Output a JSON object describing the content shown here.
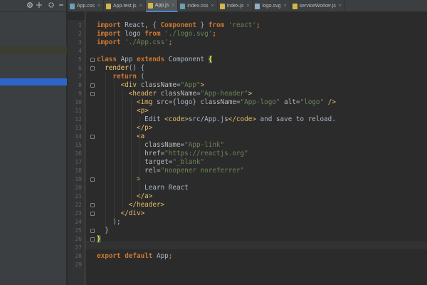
{
  "tabs": [
    {
      "label": "App.css",
      "icon_color": "#6a9fb5",
      "active": false
    },
    {
      "label": "App.test.js",
      "icon_color": "#d4b64a",
      "active": false
    },
    {
      "label": "App.js",
      "icon_color": "#d4b64a",
      "active": true
    },
    {
      "label": "index.css",
      "icon_color": "#6a9fb5",
      "active": false
    },
    {
      "label": "index.js",
      "icon_color": "#d4b64a",
      "active": false
    },
    {
      "label": "logo.svg",
      "icon_color": "#8fb0c8",
      "active": false
    },
    {
      "label": "serviceWorker.js",
      "icon_color": "#d4b64a",
      "active": false
    }
  ],
  "tab_close_glyph": "×",
  "left_toolbar": [
    "gear-icon",
    "split-icon",
    "settings-icon",
    "hide-icon"
  ],
  "code": {
    "line_numbers": [
      "1",
      "2",
      "3",
      "4",
      "5",
      "6",
      "7",
      "8",
      "9",
      "10",
      "11",
      "12",
      "13",
      "14",
      "15",
      "16",
      "17",
      "18",
      "19",
      "20",
      "21",
      "22",
      "23",
      "24",
      "25",
      "26",
      "27",
      "28",
      "29"
    ],
    "lines": [
      [
        {
          "t": "import",
          "c": "kw"
        },
        {
          "t": " React, { "
        },
        {
          "t": "Component",
          "c": "kw"
        },
        {
          "t": " } "
        },
        {
          "t": "from",
          "c": "kw"
        },
        {
          "t": " "
        },
        {
          "t": "'react'",
          "c": "str"
        },
        {
          "t": ";",
          "c": "kw"
        }
      ],
      [
        {
          "t": "import",
          "c": "kw"
        },
        {
          "t": " logo "
        },
        {
          "t": "from",
          "c": "kw"
        },
        {
          "t": " "
        },
        {
          "t": "'./logo.svg'",
          "c": "str"
        },
        {
          "t": ";",
          "c": "kw"
        }
      ],
      [
        {
          "t": "import",
          "c": "kw"
        },
        {
          "t": " "
        },
        {
          "t": "'./App.css'",
          "c": "str"
        },
        {
          "t": ";",
          "c": "kw"
        }
      ],
      [],
      [
        {
          "t": "class",
          "c": "kw"
        },
        {
          "t": " App "
        },
        {
          "t": "extends",
          "c": "kw"
        },
        {
          "t": " Component "
        },
        {
          "t": "{",
          "c": "brace-hl"
        }
      ],
      [
        {
          "t": "  "
        },
        {
          "t": "render",
          "c": "method"
        },
        {
          "t": "() {"
        }
      ],
      [
        {
          "t": "    "
        },
        {
          "t": "return",
          "c": "kw"
        },
        {
          "t": " ("
        }
      ],
      [
        {
          "t": "      "
        },
        {
          "t": "<div",
          "c": "tag"
        },
        {
          "t": " className",
          "c": "attr"
        },
        {
          "t": "="
        },
        {
          "t": "\"App\"",
          "c": "str"
        },
        {
          "t": ">",
          "c": "tag"
        }
      ],
      [
        {
          "t": "        "
        },
        {
          "t": "<header",
          "c": "tag"
        },
        {
          "t": " className",
          "c": "attr"
        },
        {
          "t": "="
        },
        {
          "t": "\"App-header\"",
          "c": "str"
        },
        {
          "t": ">",
          "c": "tag"
        }
      ],
      [
        {
          "t": "          "
        },
        {
          "t": "<img",
          "c": "tag"
        },
        {
          "t": " src",
          "c": "attr"
        },
        {
          "t": "={logo}"
        },
        {
          "t": " className",
          "c": "attr"
        },
        {
          "t": "="
        },
        {
          "t": "\"App-logo\"",
          "c": "str"
        },
        {
          "t": " alt",
          "c": "attr"
        },
        {
          "t": "="
        },
        {
          "t": "\"logo\"",
          "c": "str"
        },
        {
          "t": " />",
          "c": "tag"
        }
      ],
      [
        {
          "t": "          "
        },
        {
          "t": "<p>",
          "c": "tag"
        }
      ],
      [
        {
          "t": "            Edit "
        },
        {
          "t": "<code>",
          "c": "tag"
        },
        {
          "t": "src/App.js"
        },
        {
          "t": "</code>",
          "c": "tag"
        },
        {
          "t": " and save to reload."
        }
      ],
      [
        {
          "t": "          "
        },
        {
          "t": "</p>",
          "c": "tag"
        }
      ],
      [
        {
          "t": "          "
        },
        {
          "t": "<a",
          "c": "tag"
        }
      ],
      [
        {
          "t": "            className",
          "c": "attr"
        },
        {
          "t": "="
        },
        {
          "t": "\"App-link\"",
          "c": "str"
        }
      ],
      [
        {
          "t": "            href",
          "c": "attr"
        },
        {
          "t": "="
        },
        {
          "t": "\"https://reactjs.org\"",
          "c": "str"
        }
      ],
      [
        {
          "t": "            target",
          "c": "attr"
        },
        {
          "t": "="
        },
        {
          "t": "\"_blank\"",
          "c": "str"
        }
      ],
      [
        {
          "t": "            rel",
          "c": "attr"
        },
        {
          "t": "="
        },
        {
          "t": "\"noopener noreferrer\"",
          "c": "str"
        }
      ],
      [
        {
          "t": "          "
        },
        {
          "t": ">",
          "c": "tag"
        }
      ],
      [
        {
          "t": "            Learn React"
        }
      ],
      [
        {
          "t": "          "
        },
        {
          "t": "</a>",
          "c": "tag"
        }
      ],
      [
        {
          "t": "        "
        },
        {
          "t": "</header>",
          "c": "tag"
        }
      ],
      [
        {
          "t": "      "
        },
        {
          "t": "</div>",
          "c": "tag"
        }
      ],
      [
        {
          "t": "    );"
        }
      ],
      [
        {
          "t": "  }"
        }
      ],
      [
        {
          "t": "}",
          "c": "brace-hl"
        }
      ],
      [],
      [
        {
          "t": "export",
          "c": "kw"
        },
        {
          "t": " "
        },
        {
          "t": "default",
          "c": "kw"
        },
        {
          "t": " App"
        },
        {
          "t": ";",
          "c": "kw"
        }
      ],
      []
    ]
  },
  "colors": {
    "accent": "#4a88c7",
    "selection_blue": "#2f65ca",
    "keyword": "#cc7832",
    "string": "#6a8759",
    "tag": "#e8bf6a"
  }
}
